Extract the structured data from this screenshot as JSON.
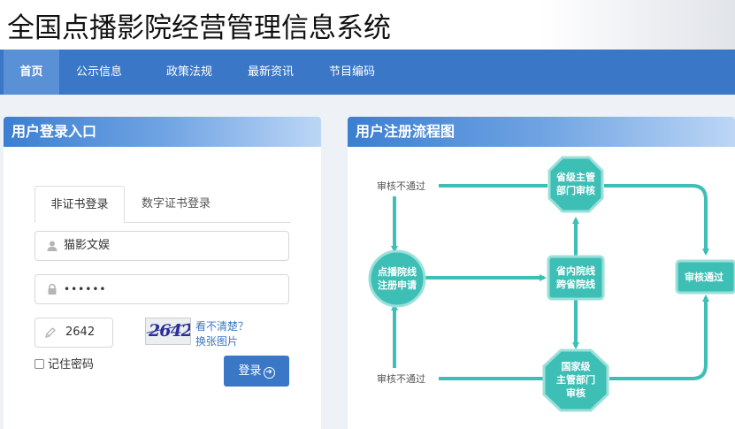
{
  "header": {
    "site_title": "全国点播影院经营管理信息系统"
  },
  "nav": {
    "items": [
      {
        "label": "首页",
        "active": true
      },
      {
        "label": "公示信息",
        "active": false
      },
      {
        "label": "政策法规",
        "active": false
      },
      {
        "label": "最新资讯",
        "active": false
      },
      {
        "label": "节目编码",
        "active": false
      }
    ]
  },
  "login": {
    "title": "用户登录入口",
    "tabs": [
      "非证书登录",
      "数字证书登录"
    ],
    "username": "猫影文娱",
    "password": "••••••",
    "captcha_input": "2642",
    "captcha_image_text": "2642",
    "captcha_hint": "看不清楚？",
    "captcha_refresh": "换张图片",
    "remember_label": "记住密码",
    "submit_label": "登录"
  },
  "flow": {
    "title": "用户注册流程图",
    "nodes": {
      "start": [
        "点播院线",
        "注册申请"
      ],
      "province_dept": [
        "省级主管",
        "部门审核"
      ],
      "route": [
        "省内院线",
        "跨省院线"
      ],
      "national_dept": [
        "国家级",
        "主管部门",
        "审核"
      ],
      "approved": "审核通过"
    },
    "labels": {
      "reject_top": "审核不通过",
      "reject_bottom": "审核不通过"
    },
    "colors": {
      "teal": "#3ebfb6",
      "accent": "#3a77c6"
    }
  }
}
